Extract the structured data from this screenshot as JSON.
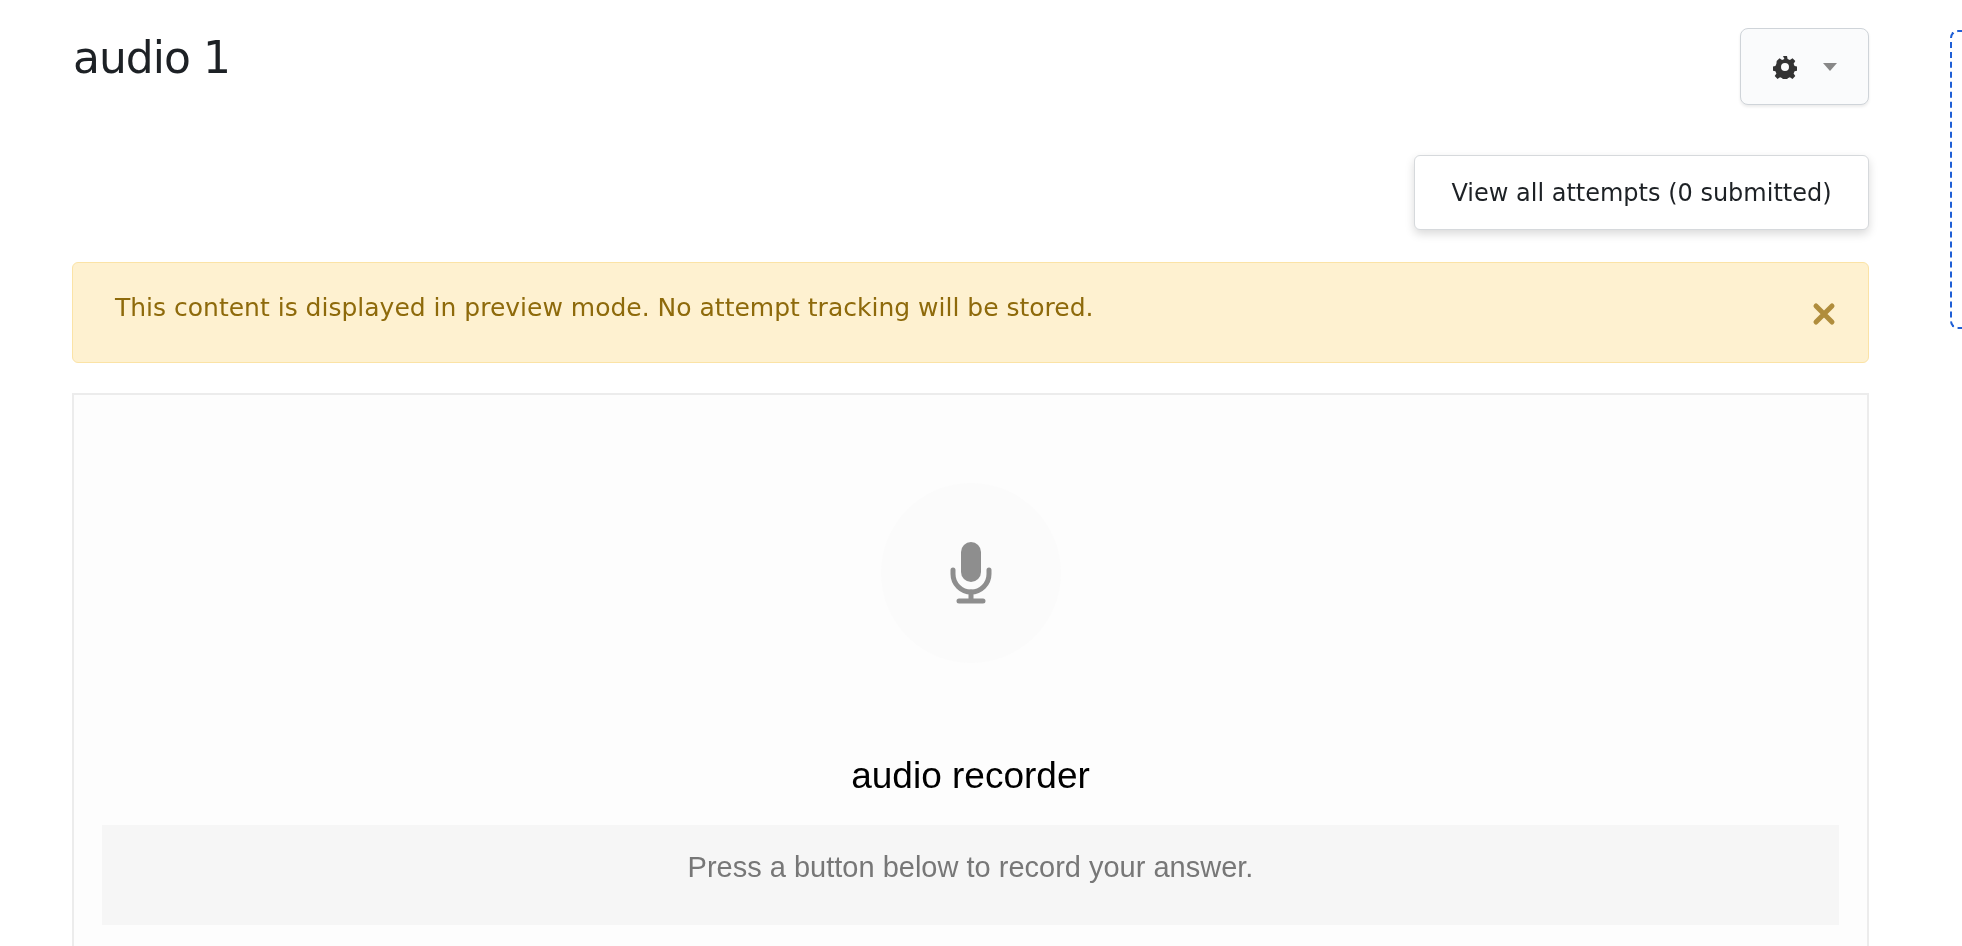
{
  "page": {
    "title": "audio 1"
  },
  "settings_menu": {
    "expanded": true,
    "items": [
      {
        "label": "View all attempts (0 submitted)"
      }
    ]
  },
  "alert": {
    "text": "This content is displayed in preview mode. No attempt tracking will be stored.",
    "dismissible": true
  },
  "recorder": {
    "title": "audio recorder",
    "status": "Press a button below to record your answer."
  }
}
